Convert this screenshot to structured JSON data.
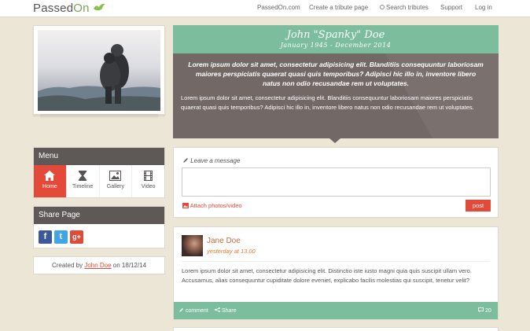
{
  "nav": {
    "logo_main": "Passed",
    "logo_accent": "On",
    "links": [
      "PassedOn.com",
      "Create a tribute page",
      "Search tributes",
      "Support",
      "Log in"
    ]
  },
  "colors": {
    "accent_red": "#e44a3a",
    "accent_green": "#7bbd9d",
    "dark_panel": "#5e5856",
    "hero_bg": "#726866"
  },
  "sidebar": {
    "menu_title": "Menu",
    "menu_items": [
      {
        "label": "Home",
        "icon": "home-icon",
        "active": true
      },
      {
        "label": "Timeline",
        "icon": "hourglass-icon",
        "active": false
      },
      {
        "label": "Gallery",
        "icon": "image-icon",
        "active": false
      },
      {
        "label": "Video",
        "icon": "film-icon",
        "active": false
      }
    ],
    "share_title": "Share Page",
    "share_icons": [
      "facebook-icon",
      "twitter-icon",
      "google-plus-icon"
    ],
    "share_letters": [
      "f",
      "t",
      "g+"
    ],
    "created_prefix": "Created by",
    "created_author": "John Doe",
    "created_suffix": "on 18/12/14"
  },
  "hero": {
    "name": "John \"Spanky\" Doe",
    "dates": "January 1945 - December 2014",
    "lead": "Lorem ipsum dolor sit amet, consectetur adipisicing elit. Blanditiis consequuntur laboriosam maiores perspiciatis quaerat quasi quis temporibus? Adipisci hic illo in, inventore libero natus non odio recusandae rem ut voluptates.",
    "body": "Lorem ipsum dolor sit amet, consectetur adipisicing elit. Blanditiis consequuntur laboriosam maiores perspiciatis quaerat quasi quis temporibus? Adipisci hic illo in, inventore libero natus non odio recusandae rem ut voluptates."
  },
  "message": {
    "label": "Leave a message",
    "placeholder": "",
    "attach_label": "Attach photos/video",
    "post_label": "post"
  },
  "post": {
    "author": "Jane Doe",
    "time": "yesterday at 13.00",
    "text": "Lorem ipsum dolor sit amet, consectetur adipisicing elit. Distinctio iste iusto magni quia quis suscipit ullam vero. Accusamus, alias consequuntur cupiditate dolore eveniet, explicabo facilis molestias qui suscipit, tenetur velit?",
    "comment_label": "comment",
    "share_label": "Share",
    "comment_count": "20"
  }
}
